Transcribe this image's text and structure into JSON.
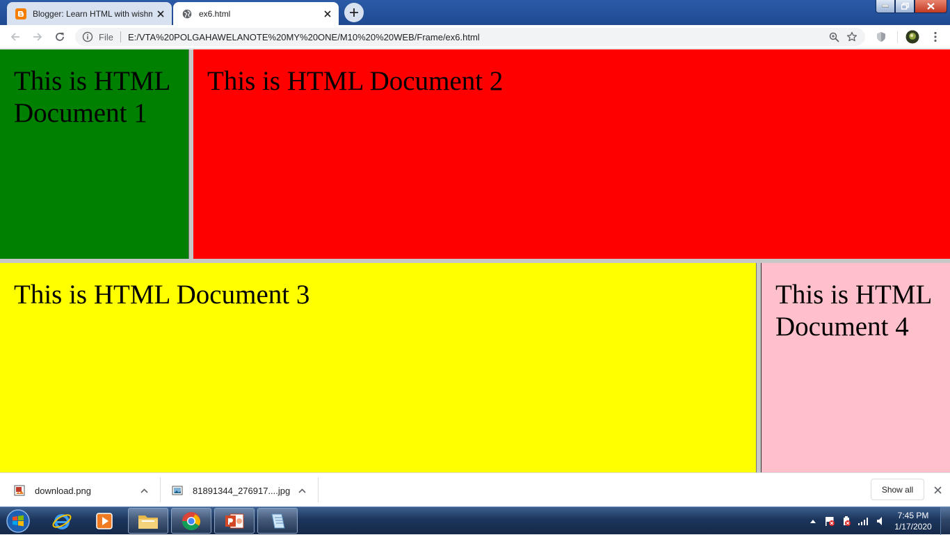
{
  "browser": {
    "tabs": [
      {
        "title": "Blogger: Learn HTML with wishm",
        "icon": "blogger-icon",
        "active": false
      },
      {
        "title": "ex6.html",
        "icon": "globe-icon",
        "active": true
      }
    ],
    "address": {
      "scheme_label": "File",
      "url": "E:/VTA%20POLGAHAWELANOTE%20MY%20ONE/M10%20%20WEB/Frame/ex6.html"
    }
  },
  "frames": [
    {
      "text": "This is HTML Document 1",
      "color": "#008000"
    },
    {
      "text": "This is HTML Document 2",
      "color": "#ff0000"
    },
    {
      "text": "This is HTML Document 3",
      "color": "#ffff00"
    },
    {
      "text": "This is HTML Document 4",
      "color": "#ffc0cb"
    }
  ],
  "downloads": {
    "items": [
      {
        "name": "download.png",
        "icon": "image-file-icon"
      },
      {
        "name": "81891344_276917....jpg",
        "icon": "image-file-icon"
      }
    ],
    "show_all_label": "Show all"
  },
  "taskbar": {
    "apps": [
      "internet-explorer-icon",
      "media-player-icon",
      "file-explorer-icon",
      "chrome-icon",
      "powerpoint-icon",
      "notepad-icon"
    ],
    "time": "7:45 PM",
    "date": "1/17/2020"
  }
}
